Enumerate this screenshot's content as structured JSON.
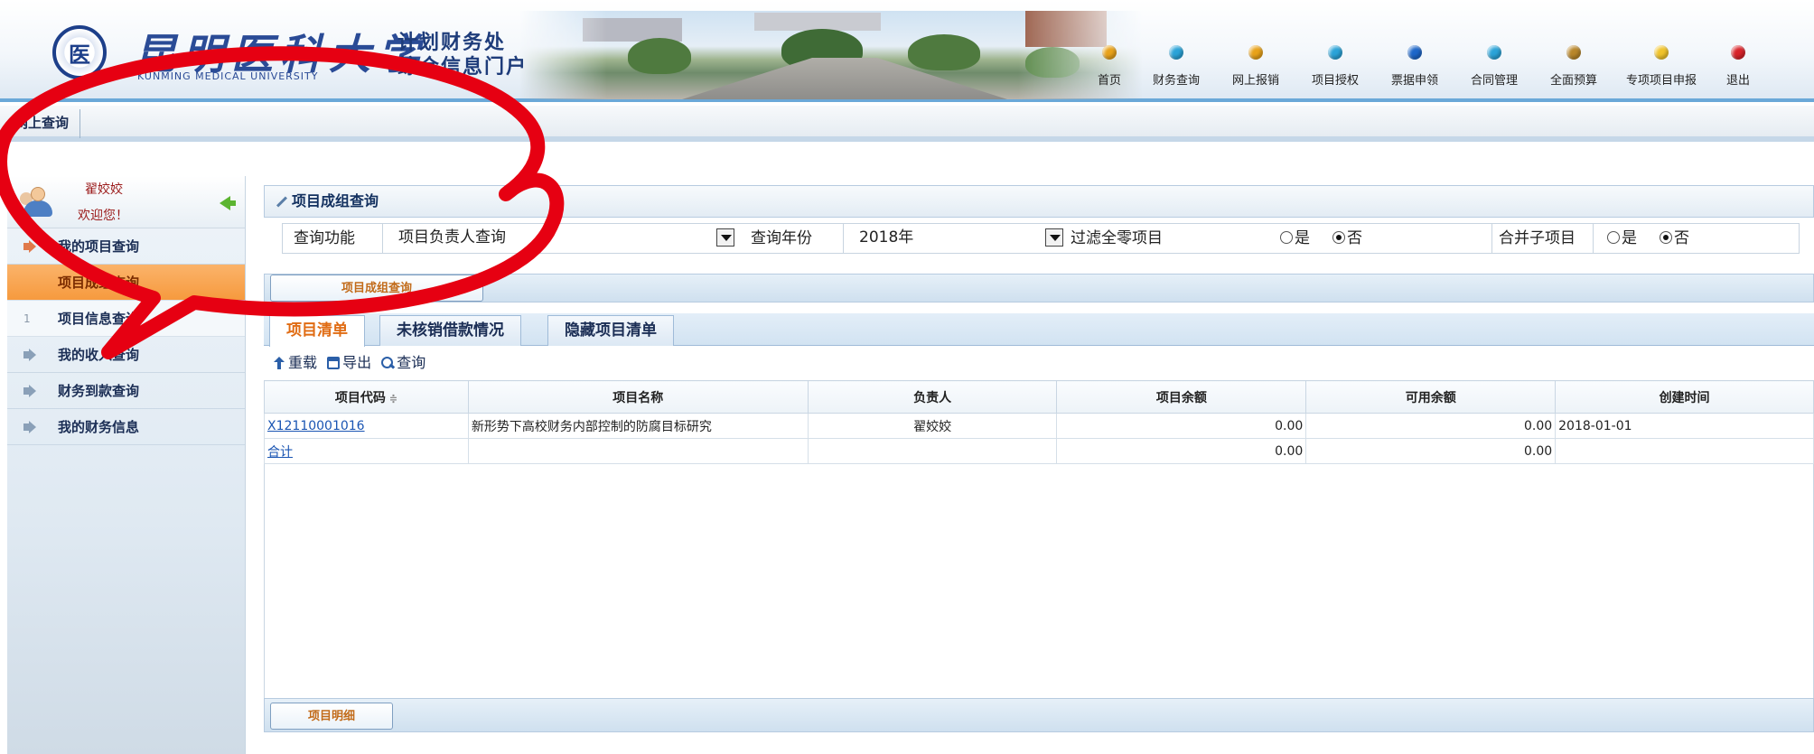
{
  "header": {
    "logo_seal": "医",
    "university_cn": "昆明医科大学",
    "university_en": "KUNMING MEDICAL UNIVERSITY",
    "portal_line1": "计划财务处",
    "portal_line2": "综合信息门户",
    "nav": [
      {
        "label": "首页",
        "color": "#e8a21a"
      },
      {
        "label": "财务查询",
        "color": "#2aa3d8"
      },
      {
        "label": "网上报销",
        "color": "#e8a21a"
      },
      {
        "label": "项目授权",
        "color": "#2aa3d8"
      },
      {
        "label": "票据申领",
        "color": "#1d66c9"
      },
      {
        "label": "合同管理",
        "color": "#2aa3d8"
      },
      {
        "label": "全面预算",
        "color": "#b8862a"
      },
      {
        "label": "专项项目申报",
        "color": "#f0c32a"
      },
      {
        "label": "退出",
        "color": "#d8232a"
      }
    ]
  },
  "tabstrip": {
    "active_tab": "网上查询"
  },
  "sidebar": {
    "username": "翟姣姣",
    "welcome": "欢迎您！",
    "menu": {
      "my_project": "我的项目查询",
      "sub_group": "项目成组查询",
      "sub_group_num": "1",
      "sub_info": "项目信息查询",
      "my_income": "我的收入查询",
      "arrival": "财务到款查询",
      "finance_info": "我的财务信息"
    }
  },
  "main": {
    "panel_title": "项目成组查询",
    "query": {
      "func_label": "查询功能",
      "func_value": "项目负责人查询",
      "year_label": "查询年份",
      "year_value": "2018年",
      "filter_label": "过滤全零项目",
      "yes": "是",
      "no": "否",
      "merge_label": "合并子项目"
    },
    "section_btn": "项目成组查询",
    "list_tabs": [
      "项目清单",
      "未核销借款情况",
      "隐藏项目清单"
    ],
    "toolbar": {
      "reload": "重载",
      "export": "导出",
      "search": "查询"
    },
    "table": {
      "headers": [
        "项目代码",
        "项目名称",
        "负责人",
        "项目余额",
        "可用余额",
        "创建时间"
      ],
      "sort_indicator": "≑",
      "rows": [
        {
          "code": "X12110001016",
          "name": "新形势下高校财务内部控制的防腐目标研究",
          "owner": "翟姣姣",
          "balance": "0.00",
          "available": "0.00",
          "created": "2018-01-01"
        }
      ],
      "total": {
        "code": "合计",
        "balance": "0.00",
        "available": "0.00"
      }
    },
    "detail_btn": "项目明细"
  }
}
